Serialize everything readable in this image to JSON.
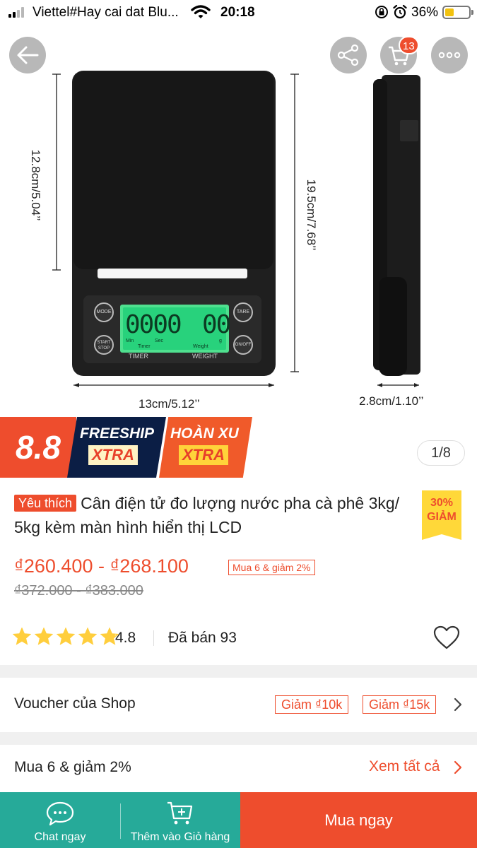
{
  "status_bar": {
    "carrier": "Viettel#Hay cai dat Blu...",
    "time": "20:18",
    "battery": "36%",
    "battery_level": 0.36
  },
  "product_image": {
    "dimension_labels": {
      "depth": "12.8cm/5.04’’",
      "height": "19.5cm/7.68’’",
      "width": "13cm/5.12’’",
      "thickness": "2.8cm/1.10’’"
    },
    "panel_labels": {
      "mode": "MODE",
      "tare": "TARE",
      "start_stop_1": "START",
      "start_stop_2": "STOP",
      "on_off": "ON/OFF",
      "timer": "TIMER",
      "weight": "WEIGHT",
      "lcd_left": "0000",
      "lcd_right": "00",
      "lcd_min": "Min",
      "lcd_sec": "Sec",
      "lcd_timer": "Timer",
      "lcd_weight": "Weight",
      "lcd_g": "g"
    },
    "cart_count": "13",
    "page_indicator": "1/8"
  },
  "promo_banner": {
    "sale": "8.8",
    "freeship": "FREESHIP",
    "freeship_sub": "XTRA",
    "hoanxu": "HOÀN XU",
    "hoanxu_sub": "XTRA"
  },
  "product": {
    "badge": "Yêu thích",
    "title": "Cân điện tử đo lượng nước pha cà phê 3kg/ 5kg kèm màn hình hiển thị LCD",
    "discount_percent": "30%",
    "discount_label": "GIẢM",
    "price": "₫260.400 - ₫268.100",
    "buy_more_tag": "Mua 6 & giảm 2%",
    "old_price": "₫372.000 - ₫383.000",
    "rating": "4.8",
    "rating_value": 4.8,
    "sold": "Đã bán 93"
  },
  "voucher": {
    "label": "Voucher của Shop",
    "chips": [
      "Giảm ₫10k",
      "Giảm ₫15k"
    ]
  },
  "bundle": {
    "label": "Mua 6 & giảm 2%",
    "see_all": "Xem tất cả"
  },
  "bottom_bar": {
    "chat": "Chat ngay",
    "add_to_cart": "Thêm vào Giỏ hàng",
    "buy_now": "Mua ngay"
  },
  "colors": {
    "accent": "#ee4d2d",
    "teal": "#26aa99",
    "star": "#ffce3d"
  }
}
